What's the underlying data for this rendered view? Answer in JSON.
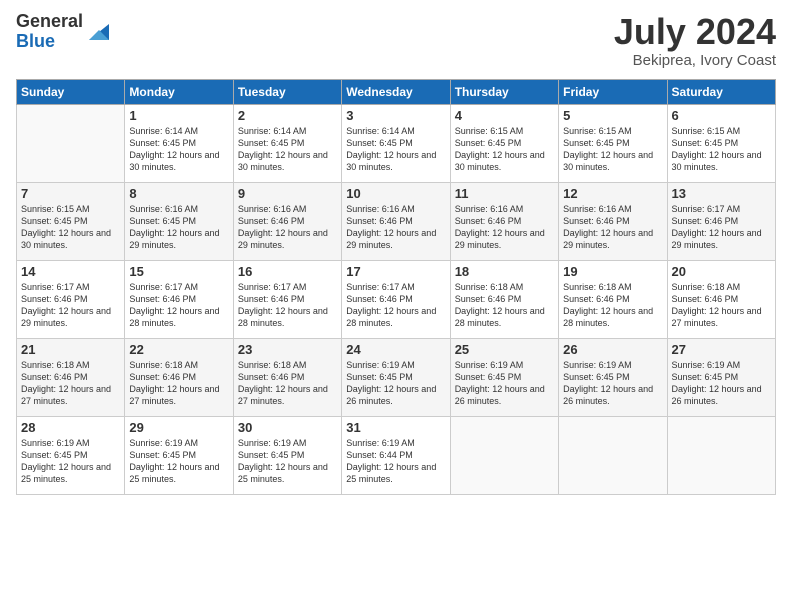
{
  "logo": {
    "general": "General",
    "blue": "Blue"
  },
  "header": {
    "month": "July 2024",
    "location": "Bekiprea, Ivory Coast"
  },
  "weekdays": [
    "Sunday",
    "Monday",
    "Tuesday",
    "Wednesday",
    "Thursday",
    "Friday",
    "Saturday"
  ],
  "weeks": [
    [
      {
        "day": "",
        "info": ""
      },
      {
        "day": "1",
        "info": "Sunrise: 6:14 AM\nSunset: 6:45 PM\nDaylight: 12 hours\nand 30 minutes."
      },
      {
        "day": "2",
        "info": "Sunrise: 6:14 AM\nSunset: 6:45 PM\nDaylight: 12 hours\nand 30 minutes."
      },
      {
        "day": "3",
        "info": "Sunrise: 6:14 AM\nSunset: 6:45 PM\nDaylight: 12 hours\nand 30 minutes."
      },
      {
        "day": "4",
        "info": "Sunrise: 6:15 AM\nSunset: 6:45 PM\nDaylight: 12 hours\nand 30 minutes."
      },
      {
        "day": "5",
        "info": "Sunrise: 6:15 AM\nSunset: 6:45 PM\nDaylight: 12 hours\nand 30 minutes."
      },
      {
        "day": "6",
        "info": "Sunrise: 6:15 AM\nSunset: 6:45 PM\nDaylight: 12 hours\nand 30 minutes."
      }
    ],
    [
      {
        "day": "7",
        "info": "Sunrise: 6:15 AM\nSunset: 6:45 PM\nDaylight: 12 hours\nand 30 minutes."
      },
      {
        "day": "8",
        "info": "Sunrise: 6:16 AM\nSunset: 6:45 PM\nDaylight: 12 hours\nand 29 minutes."
      },
      {
        "day": "9",
        "info": "Sunrise: 6:16 AM\nSunset: 6:46 PM\nDaylight: 12 hours\nand 29 minutes."
      },
      {
        "day": "10",
        "info": "Sunrise: 6:16 AM\nSunset: 6:46 PM\nDaylight: 12 hours\nand 29 minutes."
      },
      {
        "day": "11",
        "info": "Sunrise: 6:16 AM\nSunset: 6:46 PM\nDaylight: 12 hours\nand 29 minutes."
      },
      {
        "day": "12",
        "info": "Sunrise: 6:16 AM\nSunset: 6:46 PM\nDaylight: 12 hours\nand 29 minutes."
      },
      {
        "day": "13",
        "info": "Sunrise: 6:17 AM\nSunset: 6:46 PM\nDaylight: 12 hours\nand 29 minutes."
      }
    ],
    [
      {
        "day": "14",
        "info": "Sunrise: 6:17 AM\nSunset: 6:46 PM\nDaylight: 12 hours\nand 29 minutes."
      },
      {
        "day": "15",
        "info": "Sunrise: 6:17 AM\nSunset: 6:46 PM\nDaylight: 12 hours\nand 28 minutes."
      },
      {
        "day": "16",
        "info": "Sunrise: 6:17 AM\nSunset: 6:46 PM\nDaylight: 12 hours\nand 28 minutes."
      },
      {
        "day": "17",
        "info": "Sunrise: 6:17 AM\nSunset: 6:46 PM\nDaylight: 12 hours\nand 28 minutes."
      },
      {
        "day": "18",
        "info": "Sunrise: 6:18 AM\nSunset: 6:46 PM\nDaylight: 12 hours\nand 28 minutes."
      },
      {
        "day": "19",
        "info": "Sunrise: 6:18 AM\nSunset: 6:46 PM\nDaylight: 12 hours\nand 28 minutes."
      },
      {
        "day": "20",
        "info": "Sunrise: 6:18 AM\nSunset: 6:46 PM\nDaylight: 12 hours\nand 27 minutes."
      }
    ],
    [
      {
        "day": "21",
        "info": "Sunrise: 6:18 AM\nSunset: 6:46 PM\nDaylight: 12 hours\nand 27 minutes."
      },
      {
        "day": "22",
        "info": "Sunrise: 6:18 AM\nSunset: 6:46 PM\nDaylight: 12 hours\nand 27 minutes."
      },
      {
        "day": "23",
        "info": "Sunrise: 6:18 AM\nSunset: 6:46 PM\nDaylight: 12 hours\nand 27 minutes."
      },
      {
        "day": "24",
        "info": "Sunrise: 6:19 AM\nSunset: 6:45 PM\nDaylight: 12 hours\nand 26 minutes."
      },
      {
        "day": "25",
        "info": "Sunrise: 6:19 AM\nSunset: 6:45 PM\nDaylight: 12 hours\nand 26 minutes."
      },
      {
        "day": "26",
        "info": "Sunrise: 6:19 AM\nSunset: 6:45 PM\nDaylight: 12 hours\nand 26 minutes."
      },
      {
        "day": "27",
        "info": "Sunrise: 6:19 AM\nSunset: 6:45 PM\nDaylight: 12 hours\nand 26 minutes."
      }
    ],
    [
      {
        "day": "28",
        "info": "Sunrise: 6:19 AM\nSunset: 6:45 PM\nDaylight: 12 hours\nand 25 minutes."
      },
      {
        "day": "29",
        "info": "Sunrise: 6:19 AM\nSunset: 6:45 PM\nDaylight: 12 hours\nand 25 minutes."
      },
      {
        "day": "30",
        "info": "Sunrise: 6:19 AM\nSunset: 6:45 PM\nDaylight: 12 hours\nand 25 minutes."
      },
      {
        "day": "31",
        "info": "Sunrise: 6:19 AM\nSunset: 6:44 PM\nDaylight: 12 hours\nand 25 minutes."
      },
      {
        "day": "",
        "info": ""
      },
      {
        "day": "",
        "info": ""
      },
      {
        "day": "",
        "info": ""
      }
    ]
  ]
}
